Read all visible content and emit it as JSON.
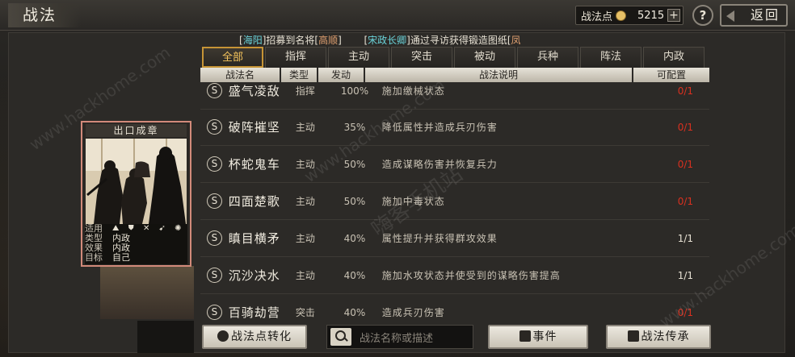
{
  "header": {
    "title": "战法",
    "points_label": "战法点",
    "points_value": "5215",
    "plus_label": "+",
    "help_label": "?",
    "back_label": "返回"
  },
  "ticker": {
    "items": [
      {
        "name": "海阳",
        "text": "招募到名将",
        "target": "高顺"
      },
      {
        "name": "宋政长卿",
        "text": "通过寻访获得锻造图纸",
        "target": "凤"
      }
    ]
  },
  "tabs": [
    {
      "label": "全部",
      "active": true
    },
    {
      "label": "指挥",
      "active": false
    },
    {
      "label": "主动",
      "active": false
    },
    {
      "label": "突击",
      "active": false
    },
    {
      "label": "被动",
      "active": false
    },
    {
      "label": "兵种",
      "active": false
    },
    {
      "label": "阵法",
      "active": false
    },
    {
      "label": "内政",
      "active": false
    }
  ],
  "table": {
    "headers": [
      "战法名",
      "类型",
      "发动",
      "战法说明",
      "可配置"
    ],
    "rows": [
      {
        "grade": "S",
        "name": "盛气凌敌",
        "type": "指挥",
        "rate": "100%",
        "desc": "施加缴械状态",
        "cfg": "0/1",
        "cfg_color": "red"
      },
      {
        "grade": "S",
        "name": "破阵摧坚",
        "type": "主动",
        "rate": "35%",
        "desc": "降低属性并造成兵刃伤害",
        "cfg": "0/1",
        "cfg_color": "red"
      },
      {
        "grade": "S",
        "name": "杯蛇鬼车",
        "type": "主动",
        "rate": "50%",
        "desc": "造成谋略伤害并恢复兵力",
        "cfg": "0/1",
        "cfg_color": "red"
      },
      {
        "grade": "S",
        "name": "四面楚歌",
        "type": "主动",
        "rate": "50%",
        "desc": "施加中毒状态",
        "cfg": "0/1",
        "cfg_color": "red"
      },
      {
        "grade": "S",
        "name": "瞋目横矛",
        "type": "主动",
        "rate": "40%",
        "desc": "属性提升并获得群攻效果",
        "cfg": "1/1",
        "cfg_color": "white"
      },
      {
        "grade": "S",
        "name": "沉沙决水",
        "type": "主动",
        "rate": "40%",
        "desc": "施加水攻状态并使受到的谋略伤害提高",
        "cfg": "1/1",
        "cfg_color": "white"
      },
      {
        "grade": "S",
        "name": "百骑劫营",
        "type": "突击",
        "rate": "40%",
        "desc": "造成兵刃伤害",
        "cfg": "0/1",
        "cfg_color": "red"
      }
    ]
  },
  "card": {
    "title": "出口成章",
    "fit_label": "适用",
    "fit_icons": "⛰ ⛊ ✕ ➹ ✺",
    "type_label": "类型",
    "type_value": "内政",
    "effect_label": "效果",
    "effect_value": "内政",
    "target_label": "目标",
    "target_value": "自己"
  },
  "buttons": {
    "convert": "战法点转化",
    "search_placeholder": "战法名称或描述",
    "events": "事件",
    "inherit": "战法传承"
  },
  "watermarks": [
    "www.hackhome.com",
    "www.hackhome.com",
    "www.hackhome.com",
    "嗨客手机站"
  ]
}
